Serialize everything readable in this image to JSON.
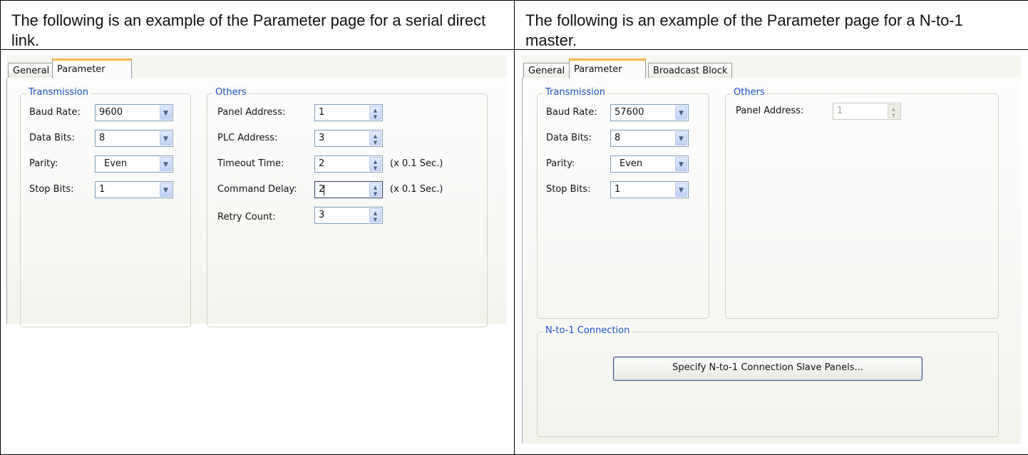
{
  "left": {
    "caption": "The following is an example of the Parameter page for a serial direct link.",
    "tabs": [
      "General",
      "Parameter"
    ],
    "transmission": {
      "legend": "Transmission",
      "baud_rate_label": "Baud Rate:",
      "baud_rate": "9600",
      "data_bits_label": "Data Bits:",
      "data_bits": "8",
      "parity_label": "Parity:",
      "parity": "Even",
      "stop_bits_label": "Stop Bits:",
      "stop_bits": "1"
    },
    "others": {
      "legend": "Others",
      "panel_address_label": "Panel Address:",
      "panel_address": "1",
      "plc_address_label": "PLC Address:",
      "plc_address": "3",
      "timeout_label": "Timeout Time:",
      "timeout": "2",
      "timeout_unit": "(x 0.1 Sec.)",
      "command_delay_label": "Command Delay:",
      "command_delay": "2",
      "command_delay_unit": "(x 0.1 Sec.)",
      "retry_label": "Retry Count:",
      "retry": "3"
    }
  },
  "right": {
    "caption": "The following is an example of the Parameter page for a N-to-1 master.",
    "tabs": [
      "General",
      "Parameter",
      "Broadcast Block"
    ],
    "transmission": {
      "legend": "Transmission",
      "baud_rate_label": "Baud Rate:",
      "baud_rate": "57600",
      "data_bits_label": "Data Bits:",
      "data_bits": "8",
      "parity_label": "Parity:",
      "parity": "Even",
      "stop_bits_label": "Stop Bits:",
      "stop_bits": "1"
    },
    "others": {
      "legend": "Others",
      "panel_address_label": "Panel Address:",
      "panel_address": "1"
    },
    "n_to_1": {
      "legend": "N-to-1 Connection",
      "button": "Specify N-to-1 Connection Slave Panels..."
    }
  }
}
